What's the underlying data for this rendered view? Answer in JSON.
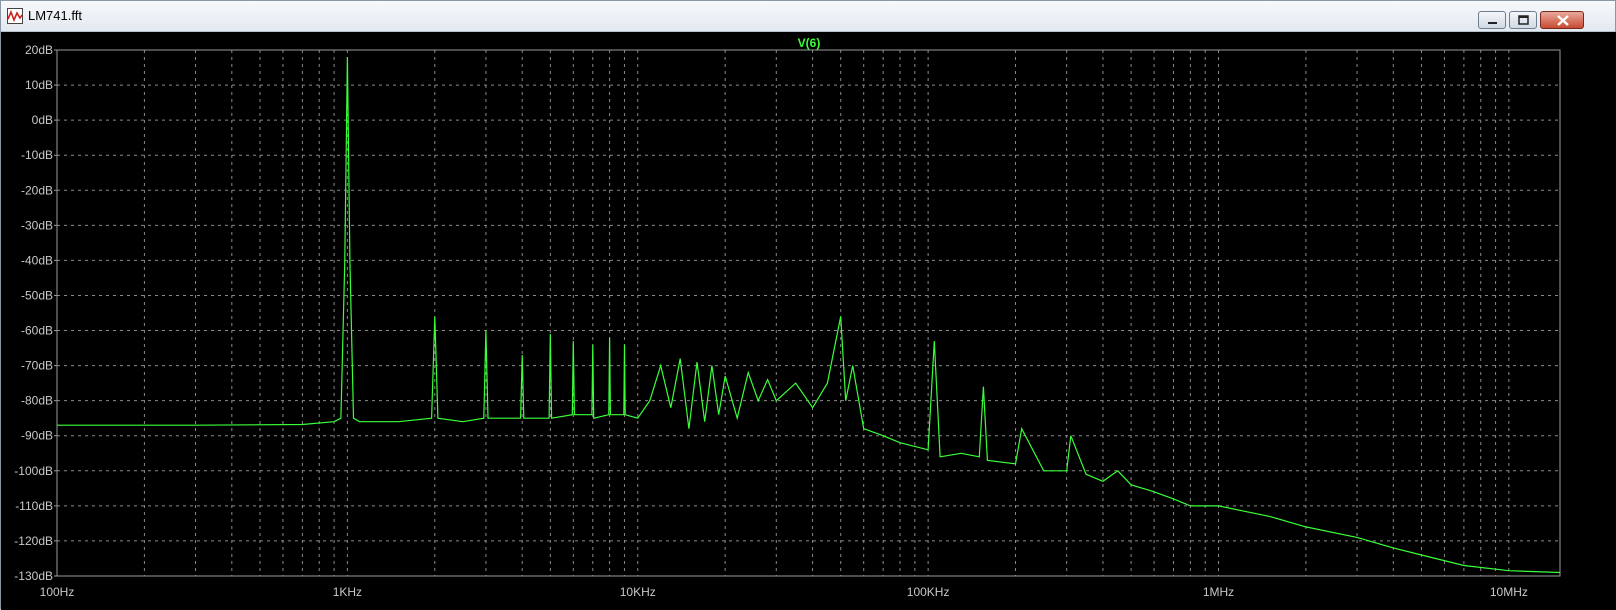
{
  "window": {
    "title": "LM741.fft",
    "buttons": {
      "minimize": "minimize",
      "restore": "restore",
      "close": "close"
    }
  },
  "colors": {
    "background": "#000000",
    "trace": "#39ff39",
    "grid": "#8a8a8a",
    "labels": "#c8c8c8"
  },
  "chart_data": {
    "type": "line",
    "title": "V(6)",
    "xlabel": "",
    "ylabel": "",
    "x_scale": "log",
    "xlim": [
      100,
      15000000
    ],
    "ylim": [
      -130,
      20
    ],
    "grid": true,
    "x_tick_labels": [
      "100Hz",
      "1KHz",
      "10KHz",
      "100KHz",
      "1MHz",
      "10MHz"
    ],
    "x_tick_values": [
      100,
      1000,
      10000,
      100000,
      1000000,
      10000000
    ],
    "y_tick_labels": [
      "20dB",
      "10dB",
      "0dB",
      "-10dB",
      "-20dB",
      "-30dB",
      "-40dB",
      "-50dB",
      "-60dB",
      "-70dB",
      "-80dB",
      "-90dB",
      "-100dB",
      "-110dB",
      "-120dB",
      "-130dB"
    ],
    "y_tick_values": [
      20,
      10,
      0,
      -10,
      -20,
      -30,
      -40,
      -50,
      -60,
      -70,
      -80,
      -90,
      -100,
      -110,
      -120,
      -130
    ],
    "series": [
      {
        "name": "V(6)",
        "x": [
          100,
          300,
          700,
          900,
          950,
          980,
          1000,
          1020,
          1050,
          1100,
          1500,
          1950,
          2000,
          2050,
          2500,
          2950,
          3000,
          3050,
          3950,
          4000,
          4050,
          4950,
          5000,
          5050,
          5950,
          6000,
          6050,
          6950,
          7000,
          7050,
          7950,
          8000,
          8050,
          8950,
          9000,
          9050,
          10000,
          11000,
          12000,
          13000,
          14000,
          15000,
          16000,
          17000,
          18000,
          19000,
          20000,
          22000,
          24000,
          26000,
          28000,
          30000,
          35000,
          40000,
          45000,
          50000,
          52000,
          55000,
          60000,
          70000,
          80000,
          100000,
          105000,
          110000,
          130000,
          150000,
          155000,
          160000,
          200000,
          210000,
          250000,
          300000,
          310000,
          350000,
          400000,
          450000,
          500000,
          600000,
          700000,
          800000,
          1000000,
          1500000,
          2000000,
          3000000,
          4000000,
          5000000,
          7000000,
          10000000,
          15000000
        ],
        "values": [
          -87,
          -87,
          -86.8,
          -86,
          -85,
          -40,
          18,
          -40,
          -85,
          -86,
          -86,
          -85,
          -56,
          -85,
          -86,
          -85,
          -60,
          -85,
          -85,
          -67,
          -85,
          -85,
          -61,
          -85,
          -84,
          -63,
          -84,
          -84,
          -64,
          -85,
          -84,
          -62,
          -84,
          -84,
          -64,
          -84,
          -85,
          -80,
          -70,
          -82,
          -68,
          -88,
          -69,
          -86,
          -70,
          -84,
          -73,
          -85,
          -72,
          -80,
          -74,
          -80,
          -75,
          -82,
          -75,
          -56,
          -80,
          -70,
          -88,
          -90,
          -92,
          -94,
          -63,
          -96,
          -95,
          -96,
          -76,
          -97,
          -98,
          -88,
          -100,
          -100,
          -90,
          -101,
          -103,
          -100,
          -104,
          -106,
          -108,
          -110,
          -110,
          -113,
          -116,
          -119,
          -122,
          -124,
          -127,
          -128.5,
          -129
        ]
      }
    ]
  }
}
